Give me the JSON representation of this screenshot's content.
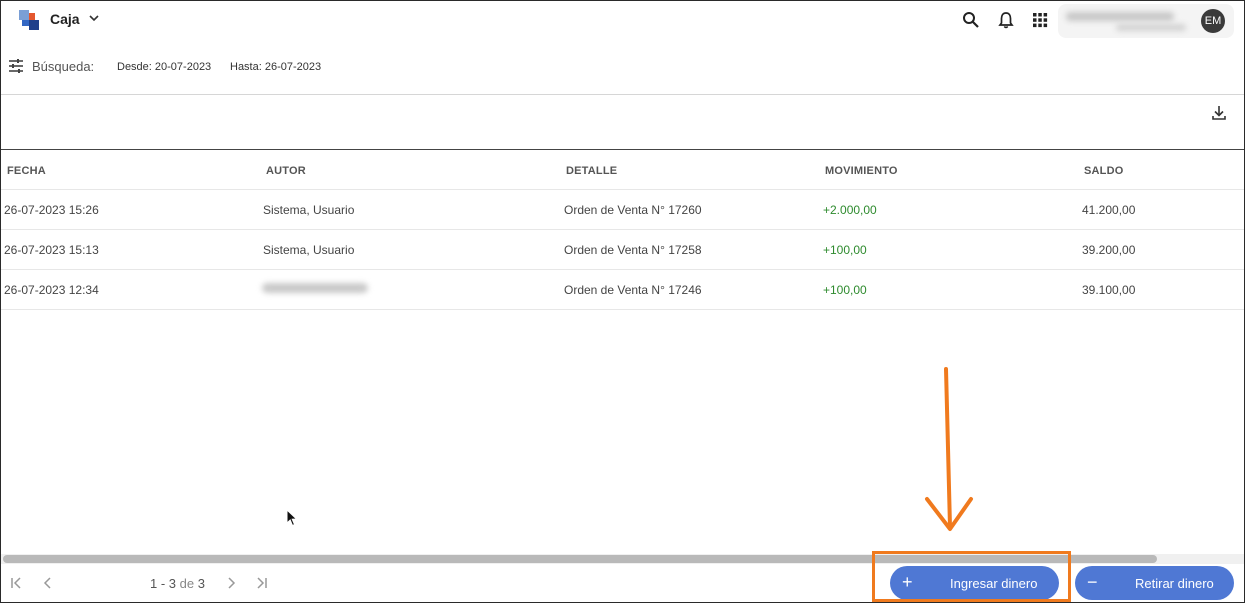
{
  "header": {
    "app_title": "Caja",
    "avatar_initials": "EM"
  },
  "filters": {
    "search_label": "Búsqueda:",
    "desde": "Desde: 20-07-2023",
    "hasta": "Hasta: 26-07-2023"
  },
  "table": {
    "columns": [
      "FECHA",
      "AUTOR",
      "DETALLE",
      "MOVIMIENTO",
      "SALDO"
    ],
    "rows": [
      {
        "fecha": "26-07-2023 15:26",
        "autor": "Sistema, Usuario",
        "detalle": "Orden de Venta N° 17260",
        "movimiento": "+2.000,00",
        "saldo": "41.200,00"
      },
      {
        "fecha": "26-07-2023 15:13",
        "autor": "Sistema, Usuario",
        "detalle": "Orden de Venta N° 17258",
        "movimiento": "+100,00",
        "saldo": "39.200,00"
      },
      {
        "fecha": "26-07-2023 12:34",
        "autor": "",
        "detalle": "Orden de Venta N° 17246",
        "movimiento": "+100,00",
        "saldo": "39.100,00"
      }
    ]
  },
  "pager": {
    "range": "1 - 3",
    "of": "de",
    "total": "3"
  },
  "actions": {
    "ingresar_label": "Ingresar dinero",
    "ingresar_symbol": "+",
    "retirar_label": "Retirar dinero",
    "retirar_symbol": "−"
  },
  "colors": {
    "accent": "#4f78d4",
    "positive": "#2e8b2e",
    "highlight": "#f07a1e"
  }
}
